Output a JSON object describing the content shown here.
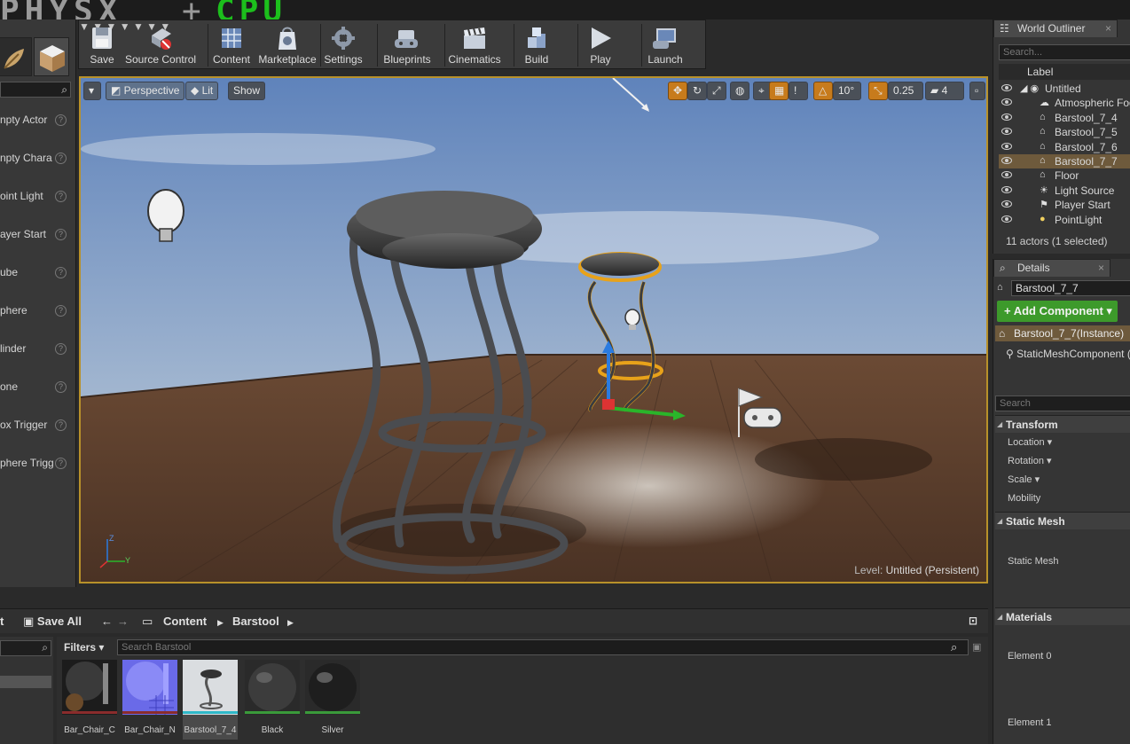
{
  "stats": {
    "physx": "PHYSX",
    "plus": "+",
    "cpu": "CPU"
  },
  "modes": {
    "items": [
      "npty Actor",
      "npty Chara",
      "oint Light",
      "ayer Start",
      "ube",
      "phere",
      "linder",
      "one",
      "ox Trigger",
      "phere Trigg"
    ]
  },
  "toolbar": {
    "save": "Save",
    "source_control": "Source Control",
    "content": "Content",
    "marketplace": "Marketplace",
    "settings": "Settings",
    "blueprints": "Blueprints",
    "cinematics": "Cinematics",
    "build": "Build",
    "play": "Play",
    "launch": "Launch"
  },
  "viewport": {
    "perspective": "Perspective",
    "lit": "Lit",
    "show": "Show",
    "rotation_snap": "10°",
    "scale_snap": "0.25",
    "camera_speed": "4",
    "level_label": "Level:",
    "level_name": "Untitled (Persistent)"
  },
  "outliner": {
    "tab": "World Outliner",
    "search_placeholder": "Search...",
    "column_label": "Label",
    "items": [
      {
        "label": "Untitled",
        "icon": "world-icon",
        "selected": false
      },
      {
        "label": "Atmospheric Fog",
        "icon": "fog-icon",
        "selected": false
      },
      {
        "label": "Barstool_7_4",
        "icon": "actor-icon",
        "selected": false
      },
      {
        "label": "Barstool_7_5",
        "icon": "actor-icon",
        "selected": false
      },
      {
        "label": "Barstool_7_6",
        "icon": "actor-icon",
        "selected": false
      },
      {
        "label": "Barstool_7_7",
        "icon": "actor-icon",
        "selected": true
      },
      {
        "label": "Floor",
        "icon": "actor-icon",
        "selected": false
      },
      {
        "label": "Light Source",
        "icon": "sun-icon",
        "selected": false
      },
      {
        "label": "Player Start",
        "icon": "player-start-icon",
        "selected": false
      },
      {
        "label": "PointLight",
        "icon": "bulb-icon",
        "selected": false
      }
    ],
    "count": "11 actors (1 selected)"
  },
  "details": {
    "tab": "Details",
    "name": "Barstool_7_7",
    "add_component": "+ Add Component ▾",
    "instance": "Barstool_7_7(Instance)",
    "component": "StaticMeshComponent (Ir",
    "search_placeholder": "Search",
    "transform": "Transform",
    "location": "Location ▾",
    "rotation": "Rotation ▾",
    "scale": "Scale ▾",
    "mobility": "Mobility",
    "static_mesh_header": "Static Mesh",
    "static_mesh_prop": "Static Mesh",
    "materials_header": "Materials",
    "element0": "Element 0",
    "element1": "Element 1"
  },
  "content_browser": {
    "import": "t",
    "save_all": "Save All",
    "path_root": "Content",
    "path_folder": "Barstool",
    "filters": "Filters ▾",
    "search_placeholder": "Search Barstool",
    "assets": [
      {
        "name": "Bar_Chair_C",
        "type_color": "#8a2c2c"
      },
      {
        "name": "Bar_Chair_N",
        "type_color": "#8a2c2c"
      },
      {
        "name": "Barstool_7_4",
        "type_color": "#2fb8c8"
      },
      {
        "name": "Black",
        "type_color": "#3a9a3a"
      },
      {
        "name": "Silver",
        "type_color": "#3a9a3a"
      }
    ]
  },
  "colors": {
    "selection_outline": "#e8a21a",
    "add_component_green": "#3d9a2b",
    "cpu_green": "#1cbf1c"
  }
}
